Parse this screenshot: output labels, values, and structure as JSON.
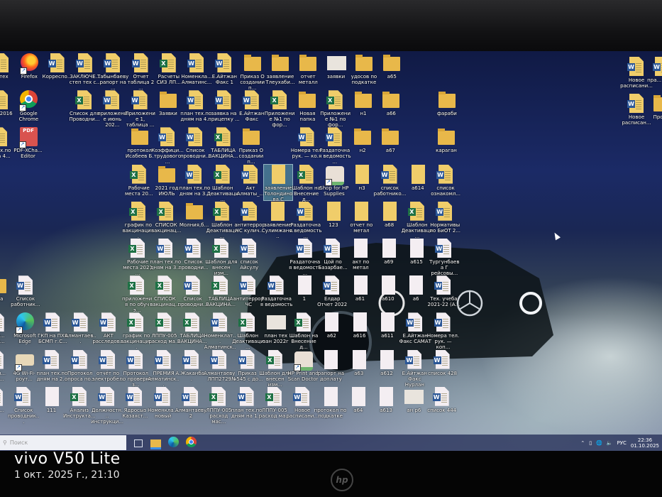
{
  "desktop": {
    "rows": [
      [
        {
          "type": "shortcut",
          "label": "...тех"
        },
        {
          "type": "firefox",
          "label": "Firefox"
        },
        {
          "type": "word",
          "label": "Корреспо..."
        },
        {
          "type": "word",
          "label": "ЗАКЛЮЧЕ... степ тех с..."
        },
        {
          "type": "word",
          "label": "Табынбаеву рапорт на ..."
        },
        {
          "type": "word",
          "label": "Отчет таблица 2 ..."
        },
        {
          "type": "excel",
          "label": "Расчеты СИЗ ЛП..."
        },
        {
          "type": "word",
          "label": "Номенкла... Алматинс..."
        },
        {
          "type": "word",
          "label": "Е.Айтжан Факс 1"
        },
        {
          "type": "folder",
          "label": "Приказ О создании п..."
        },
        {
          "type": "folder",
          "label": "заявление Тлеухаби..."
        },
        {
          "type": "folder",
          "label": "отчет металл"
        },
        {
          "type": "image",
          "label": "заявки"
        },
        {
          "type": "folder",
          "label": "удосов по подкатке"
        },
        {
          "type": "folder",
          "label": "а65"
        },
        null,
        null
      ],
      [
        {
          "type": "excel",
          "label": "...el 2016"
        },
        {
          "type": "chrome",
          "label": "Google Chrome"
        },
        null,
        {
          "type": "excel",
          "label": "Список для Проводни..."
        },
        {
          "type": "word",
          "label": "приложение июнь 202..."
        },
        {
          "type": "word",
          "label": "Приложение 1, таблица ..."
        },
        {
          "type": "folder",
          "label": "Заявки"
        },
        {
          "type": "word",
          "label": "план тех.по дням на 4..."
        },
        {
          "type": "word",
          "label": "заявка на прицепку ..."
        },
        {
          "type": "word",
          "label": "Е.Айтжан Факс"
        },
        {
          "type": "excel",
          "label": "Приложение №1 по фор..."
        },
        {
          "type": "folder",
          "label": "Новая папка"
        },
        {
          "type": "excel",
          "label": "Приложение №1 по фор..."
        },
        {
          "type": "folder",
          "label": "н1"
        },
        {
          "type": "folder",
          "label": "а66"
        },
        null,
        {
          "type": "folder",
          "label": "фараби"
        }
      ],
      [
        {
          "type": "word",
          "label": "...тех.по ...на 4..."
        },
        {
          "type": "pdf",
          "label": "PDF-XCha... Editor"
        },
        null,
        null,
        null,
        {
          "type": "folder",
          "label": "протокол Исабеев Б."
        },
        {
          "type": "word",
          "label": "Коэффици... трудового ..."
        },
        {
          "type": "word",
          "label": "Список проводни..."
        },
        {
          "type": "excel",
          "label": "ТАБЛИЦА ВАКЦИНА..."
        },
        {
          "type": "folder",
          "label": "Приказ О создании п..."
        },
        null,
        {
          "type": "word",
          "label": "Номера тел. рук. — ко..."
        },
        {
          "type": "word",
          "label": "Раздаточная ведомость ..."
        },
        {
          "type": "folder",
          "label": "н2"
        },
        {
          "type": "folder",
          "label": "а67"
        },
        null,
        {
          "type": "folder",
          "label": "караган"
        }
      ],
      [
        null,
        null,
        null,
        null,
        null,
        {
          "type": "excel",
          "label": "Рабочие места 20..."
        },
        {
          "type": "folder",
          "label": "2021 год ИЮЛЬ"
        },
        {
          "type": "word",
          "label": "план тех.по дням на 3..."
        },
        {
          "type": "excel",
          "label": "Шаблон Деактиваци..."
        },
        {
          "type": "word",
          "label": "Акт Алматы_..."
        },
        {
          "type": "blank",
          "label": "заявление Толондино ва С",
          "selected": true
        },
        {
          "type": "excel",
          "label": "Шаблон на Внесение д..."
        },
        {
          "type": "hp",
          "label": "Shop for HP Supplies"
        },
        {
          "type": "blank",
          "label": "н3"
        },
        {
          "type": "word",
          "label": "список работнико..."
        },
        {
          "type": "blank",
          "label": "а614"
        },
        {
          "type": "word",
          "label": "список ознакомл..."
        }
      ],
      [
        null,
        null,
        null,
        null,
        null,
        {
          "type": "excel",
          "label": "график по вакцинаци..."
        },
        {
          "type": "excel",
          "label": "СПИСОК вакцинац..."
        },
        {
          "type": "folder",
          "label": "Молния,б..."
        },
        {
          "type": "excel",
          "label": "Шаблон Деактиваци..."
        },
        {
          "type": "word",
          "label": "антитеррор ЧС кулич..."
        },
        {
          "type": "blank",
          "label": "заявление Сулимжано..."
        },
        {
          "type": "word",
          "label": "Раздаточная ведомость ..."
        },
        {
          "type": "blank",
          "label": "123"
        },
        {
          "type": "blank",
          "label": "отчет по метал"
        },
        {
          "type": "blank",
          "label": "а68"
        },
        {
          "type": "excel",
          "label": "Шаблон Деактиваци..."
        },
        {
          "type": "word",
          "label": "Нормативы по БиОТ 2..."
        }
      ],
      [
        null,
        null,
        null,
        null,
        null,
        {
          "type": "excel",
          "label": "Рабочие места 2021 ..."
        },
        {
          "type": "word",
          "label": "план тех.по дням на 3..."
        },
        {
          "type": "word",
          "label": "Список проводни..."
        },
        {
          "type": "excel",
          "label": "Шаблон для внесен изм..."
        },
        {
          "type": "word",
          "label": "список Айсулу"
        },
        null,
        {
          "type": "word",
          "label": "Раздаточная ведомость ..."
        },
        {
          "type": "word",
          "label": "Цой по Базарбае..."
        },
        {
          "type": "blank",
          "label": "акт по метал"
        },
        {
          "type": "blank",
          "label": "а69"
        },
        {
          "type": "blank",
          "label": "а615"
        },
        {
          "type": "word",
          "label": "Тургунбаева Г рейсовы..."
        }
      ],
      [
        {
          "type": "folder",
          "label": "...на"
        },
        {
          "type": "word",
          "label": "Список работник..."
        },
        null,
        null,
        null,
        {
          "type": "excel",
          "label": "приложения по обуч э..."
        },
        {
          "type": "excel",
          "label": "СПИСОК вакцинац..."
        },
        {
          "type": "word",
          "label": "Список проводни..."
        },
        {
          "type": "excel",
          "label": "ТАБЛИЦА ВАКЦИНА..."
        },
        {
          "type": "word",
          "label": "антитеррор ЧС"
        },
        {
          "type": "word",
          "label": "Раздаточная ведомость"
        },
        {
          "type": "blank",
          "label": "1"
        },
        {
          "type": "word",
          "label": "Елдар Отчет 2022"
        },
        {
          "type": "blank",
          "label": "а61"
        },
        {
          "type": "blank",
          "label": "а610"
        },
        {
          "type": "blank",
          "label": "а6"
        },
        {
          "type": "word",
          "label": "Тех. учеба 2021-22 (А..."
        }
      ],
      [
        {
          "type": "shortcut",
          "label": "...ер... ...ур..."
        },
        {
          "type": "edge",
          "label": "Microsoft Edge"
        },
        {
          "type": "word",
          "label": "ГКП на ПХВ БСМП г.С..."
        },
        {
          "type": "word",
          "label": "Алмантаев..."
        },
        {
          "type": "word",
          "label": "АКТ расследов..."
        },
        {
          "type": "excel",
          "label": "график по вакцинаци..."
        },
        {
          "type": "excel",
          "label": "ЛППУ-005 расход ма..."
        },
        {
          "type": "excel",
          "label": "ТАБЛИЦА ВАКЦИНА..."
        },
        {
          "type": "word",
          "label": "Номенклат... Алматинск..."
        },
        {
          "type": "excel",
          "label": "Шаблон Деактиваци..."
        },
        {
          "type": "image",
          "label": "план тех зан 2022г"
        },
        {
          "type": "excel",
          "label": "Шаблон на Внесение д..."
        },
        {
          "type": "blank",
          "label": "а62"
        },
        {
          "type": "blank",
          "label": "а616"
        },
        {
          "type": "blank",
          "label": "а611"
        },
        {
          "type": "word",
          "label": "Е.Айтжан Факс САМАТ"
        },
        {
          "type": "word",
          "label": "Номера тел. рук. — коп..."
        }
      ],
      [
        {
          "type": "shortcut",
          "label": "...оун... ...ер..."
        },
        {
          "type": "router",
          "label": "4G Wi-Fi-роут..."
        },
        {
          "type": "word",
          "label": "план тех.по дням на 2..."
        },
        {
          "type": "word",
          "label": "Протокол опроса по..."
        },
        {
          "type": "word",
          "label": "отчёт по электробе..."
        },
        {
          "type": "word",
          "label": "Протокол по проверке з..."
        },
        {
          "type": "word",
          "label": "ПРЕМИЯ Алматинск..."
        },
        {
          "type": "word",
          "label": "А.Жаканба..."
        },
        {
          "type": "word",
          "label": "Алмантаеву ЛПП2729"
        },
        {
          "type": "word",
          "label": "Приказ №545 с до..."
        },
        {
          "type": "excel",
          "label": "Шаблон для внесен изм..."
        },
        {
          "type": "hp",
          "label": "HP Print and Scan Doctor"
        },
        {
          "type": "blank",
          "label": "рапорт на доплату"
        },
        {
          "type": "blank",
          "label": "а63"
        },
        {
          "type": "blank",
          "label": "а612"
        },
        {
          "type": "word",
          "label": "Е.Айтжан Факс Нурлан"
        },
        {
          "type": "word",
          "label": "список 428"
        }
      ],
      [
        {
          "type": "excel",
          "label": "...ль ..."
        },
        {
          "type": "word",
          "label": "Список проводник..."
        },
        {
          "type": "blank",
          "label": "111"
        },
        {
          "type": "excel",
          "label": "Анализ Инструкта..."
        },
        {
          "type": "word",
          "label": "Должностн... инструкци..."
        },
        {
          "type": "word",
          "label": "Ядросыз Казахст..."
        },
        {
          "type": "word",
          "label": "Номенкла... новый"
        },
        {
          "type": "word",
          "label": "Алмантаеву2"
        },
        {
          "type": "excel",
          "label": "ЛППУ-005 расход мас..."
        },
        {
          "type": "word",
          "label": "план тех.по дням на 1..."
        },
        {
          "type": "excel",
          "label": "ЛППУ-005 расход ма..."
        },
        {
          "type": "word",
          "label": "Новое расписани..."
        },
        {
          "type": "blank",
          "label": "протокол по подкатке"
        },
        {
          "type": "blank",
          "label": "а64"
        },
        {
          "type": "blank",
          "label": "а613"
        },
        {
          "type": "image",
          "label": "ан р6"
        },
        {
          "type": "word",
          "label": "список 444"
        }
      ]
    ],
    "right_columns": [
      [
        {
          "type": "word",
          "label": "Новое расписани..."
        },
        {
          "type": "word",
          "label": "Новое расписан..."
        }
      ],
      [
        {
          "type": "word",
          "label": "пра... убо..."
        },
        {
          "type": "folder",
          "label": "Прот..."
        }
      ]
    ]
  },
  "taskbar": {
    "search_placeholder": "Поиск",
    "pinned": [
      "task-view-icon",
      "file-explorer-icon",
      "edge-icon",
      "chrome-icon"
    ],
    "tray": {
      "language": "РУС",
      "time": "22:36",
      "date": "01.10.2025"
    }
  },
  "photo_overlay": {
    "device": "vivo V50 Lite",
    "timestamp": "1 окт. 2025 г., 21:10",
    "monitor_brand": "hp"
  },
  "colors": {
    "word": "#2b5797",
    "excel": "#1e7145",
    "folder": "#e8b84a",
    "taskbar": "#283260"
  }
}
